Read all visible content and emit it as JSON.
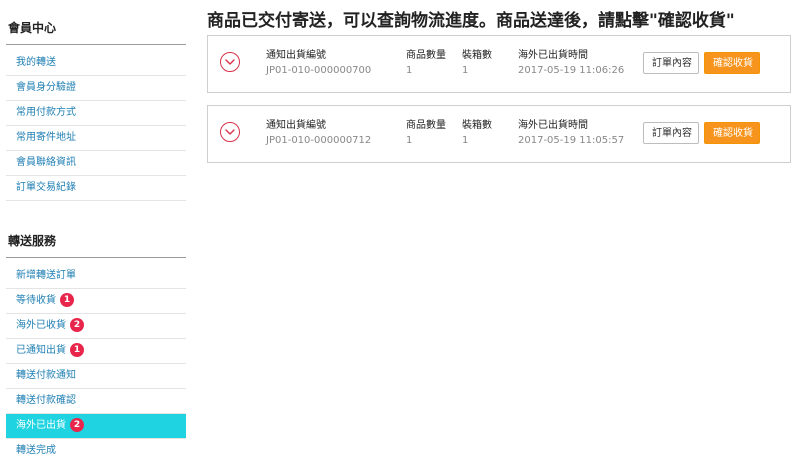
{
  "sidebar": {
    "member_title": "會員中心",
    "member_items": [
      {
        "label": "我的轉送",
        "badge": ""
      },
      {
        "label": "會員身分驗證",
        "badge": ""
      },
      {
        "label": "常用付款方式",
        "badge": ""
      },
      {
        "label": "常用寄件地址",
        "badge": ""
      },
      {
        "label": "會員聯絡資訊",
        "badge": ""
      },
      {
        "label": "訂單交易紀錄",
        "badge": ""
      }
    ],
    "transfer_title": "轉送服務",
    "transfer_items": [
      {
        "label": "新增轉送訂單",
        "badge": ""
      },
      {
        "label": "等待收貨",
        "badge": "1"
      },
      {
        "label": "海外已收貨",
        "badge": "2"
      },
      {
        "label": "已通知出貨",
        "badge": "1"
      },
      {
        "label": "轉送付款通知",
        "badge": ""
      },
      {
        "label": "轉送付款確認",
        "badge": ""
      },
      {
        "label": "海外已出貨",
        "badge": "2",
        "active": true
      },
      {
        "label": "轉送完成",
        "badge": ""
      }
    ]
  },
  "main": {
    "title": "商品已交付寄送，可以查詢物流進度。商品送達後，請點擊\"確認收貨\"",
    "columns": {
      "notice_no": "通知出貨編號",
      "qty": "商品數量",
      "boxes": "裝箱數",
      "ship_time": "海外已出貨時間"
    },
    "buttons": {
      "detail": "訂單內容",
      "confirm": "確認收貨"
    },
    "orders": [
      {
        "notice_no": "JP01-010-000000700",
        "qty": "1",
        "boxes": "1",
        "ship_time": "2017-05-19 11:06:26"
      },
      {
        "notice_no": "JP01-010-000000712",
        "qty": "1",
        "boxes": "1",
        "ship_time": "2017-05-19 11:05:57"
      }
    ]
  },
  "colors": {
    "accent": "#1fd4e0",
    "badge": "#e8264c",
    "confirm": "#f7941d",
    "link": "#1f7fb3"
  },
  "icons": {
    "toggle": "chevron-down-circle-icon"
  }
}
